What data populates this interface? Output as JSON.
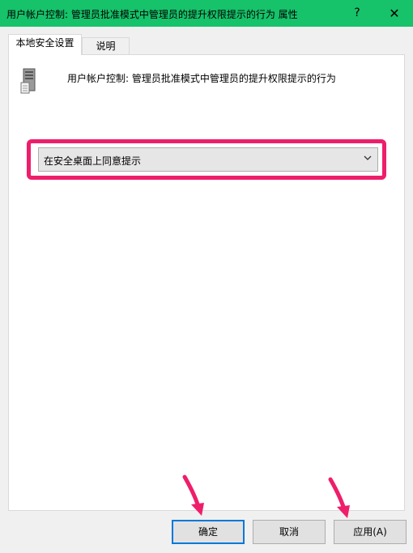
{
  "window": {
    "title": "用户帐户控制: 管理员批准模式中管理员的提升权限提示的行为 属性",
    "help_label": "?",
    "close_label": "✕"
  },
  "tabs": [
    {
      "label": "本地安全设置",
      "active": true
    },
    {
      "label": "说明",
      "active": false
    }
  ],
  "policy": {
    "name": "用户帐户控制: 管理员批准模式中管理员的提升权限提示的行为",
    "icon": "server-icon"
  },
  "setting": {
    "selected": "在安全桌面上同意提示"
  },
  "buttons": {
    "ok": "确定",
    "cancel": "取消",
    "apply": "应用(A)"
  },
  "colors": {
    "titlebar": "#16c26a",
    "highlight": "#ee1e6b",
    "ok_border": "#0078d7"
  }
}
